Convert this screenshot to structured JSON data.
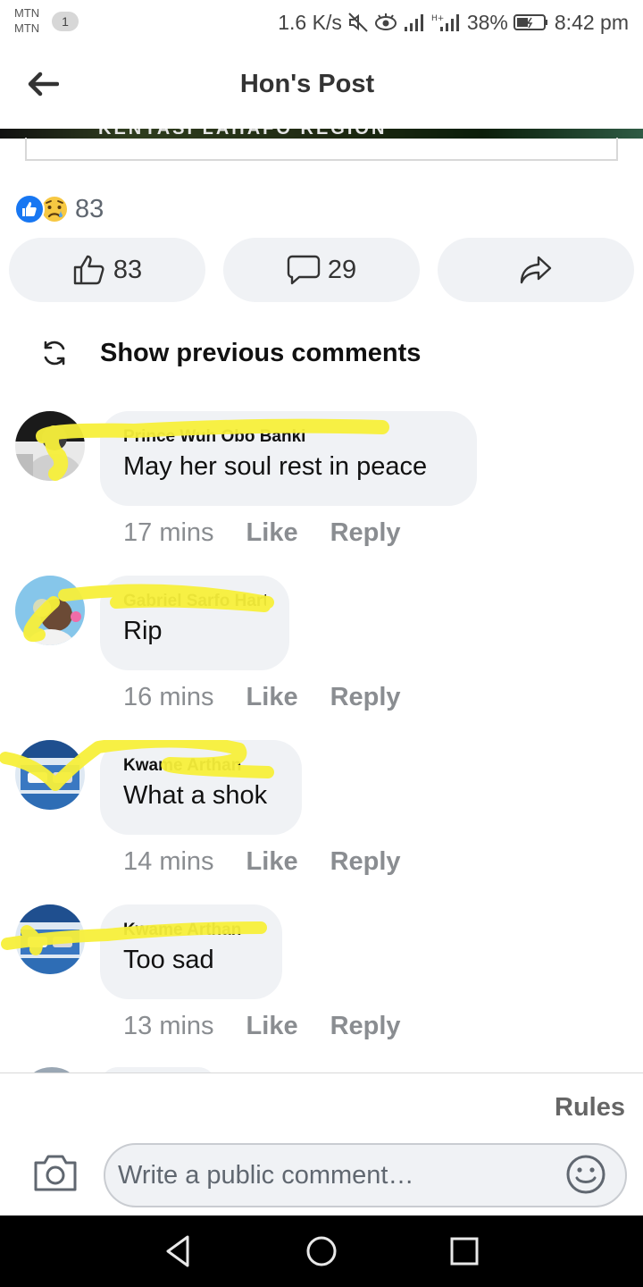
{
  "status_bar": {
    "carrier_line1": "MTN",
    "carrier_line2": "MTN",
    "notification_count": "1",
    "net_speed": "1.6 K/s",
    "battery": "38%",
    "time": "8:42 pm"
  },
  "header": {
    "title": "Hon's Post",
    "back_icon": "arrow-left-icon"
  },
  "post_image": {
    "visible_text": "KENYASI LAHAFO REGION"
  },
  "reactions": {
    "count": "83",
    "icons": [
      "like-reaction-icon",
      "sad-reaction-icon"
    ]
  },
  "actions": {
    "like_count": "83",
    "comment_count": "29",
    "share_icon": "share-icon"
  },
  "show_previous_label": "Show previous comments",
  "comments": [
    {
      "name": "Prince Wuh Obo Banki",
      "text": "May her soul rest in peace",
      "time": "17 mins",
      "like": "Like",
      "reply": "Reply"
    },
    {
      "name": "Gabriel Sarfo Hart",
      "text": "Rip",
      "time": "16 mins",
      "like": "Like",
      "reply": "Reply"
    },
    {
      "name": "Kwame Arthan",
      "text": "What a shok",
      "time": "14 mins",
      "like": "Like",
      "reply": "Reply"
    },
    {
      "name": "Kwame Arthan",
      "text": "Too sad",
      "time": "13 mins",
      "like": "Like",
      "reply": "Reply"
    }
  ],
  "composer": {
    "rules_label": "Rules",
    "placeholder": "Write a public comment…"
  },
  "colors": {
    "accent": "#1877f2",
    "bubble_bg": "#f0f2f5",
    "highlighter": "#f7ef3a",
    "meta_text": "#8a8d91"
  }
}
